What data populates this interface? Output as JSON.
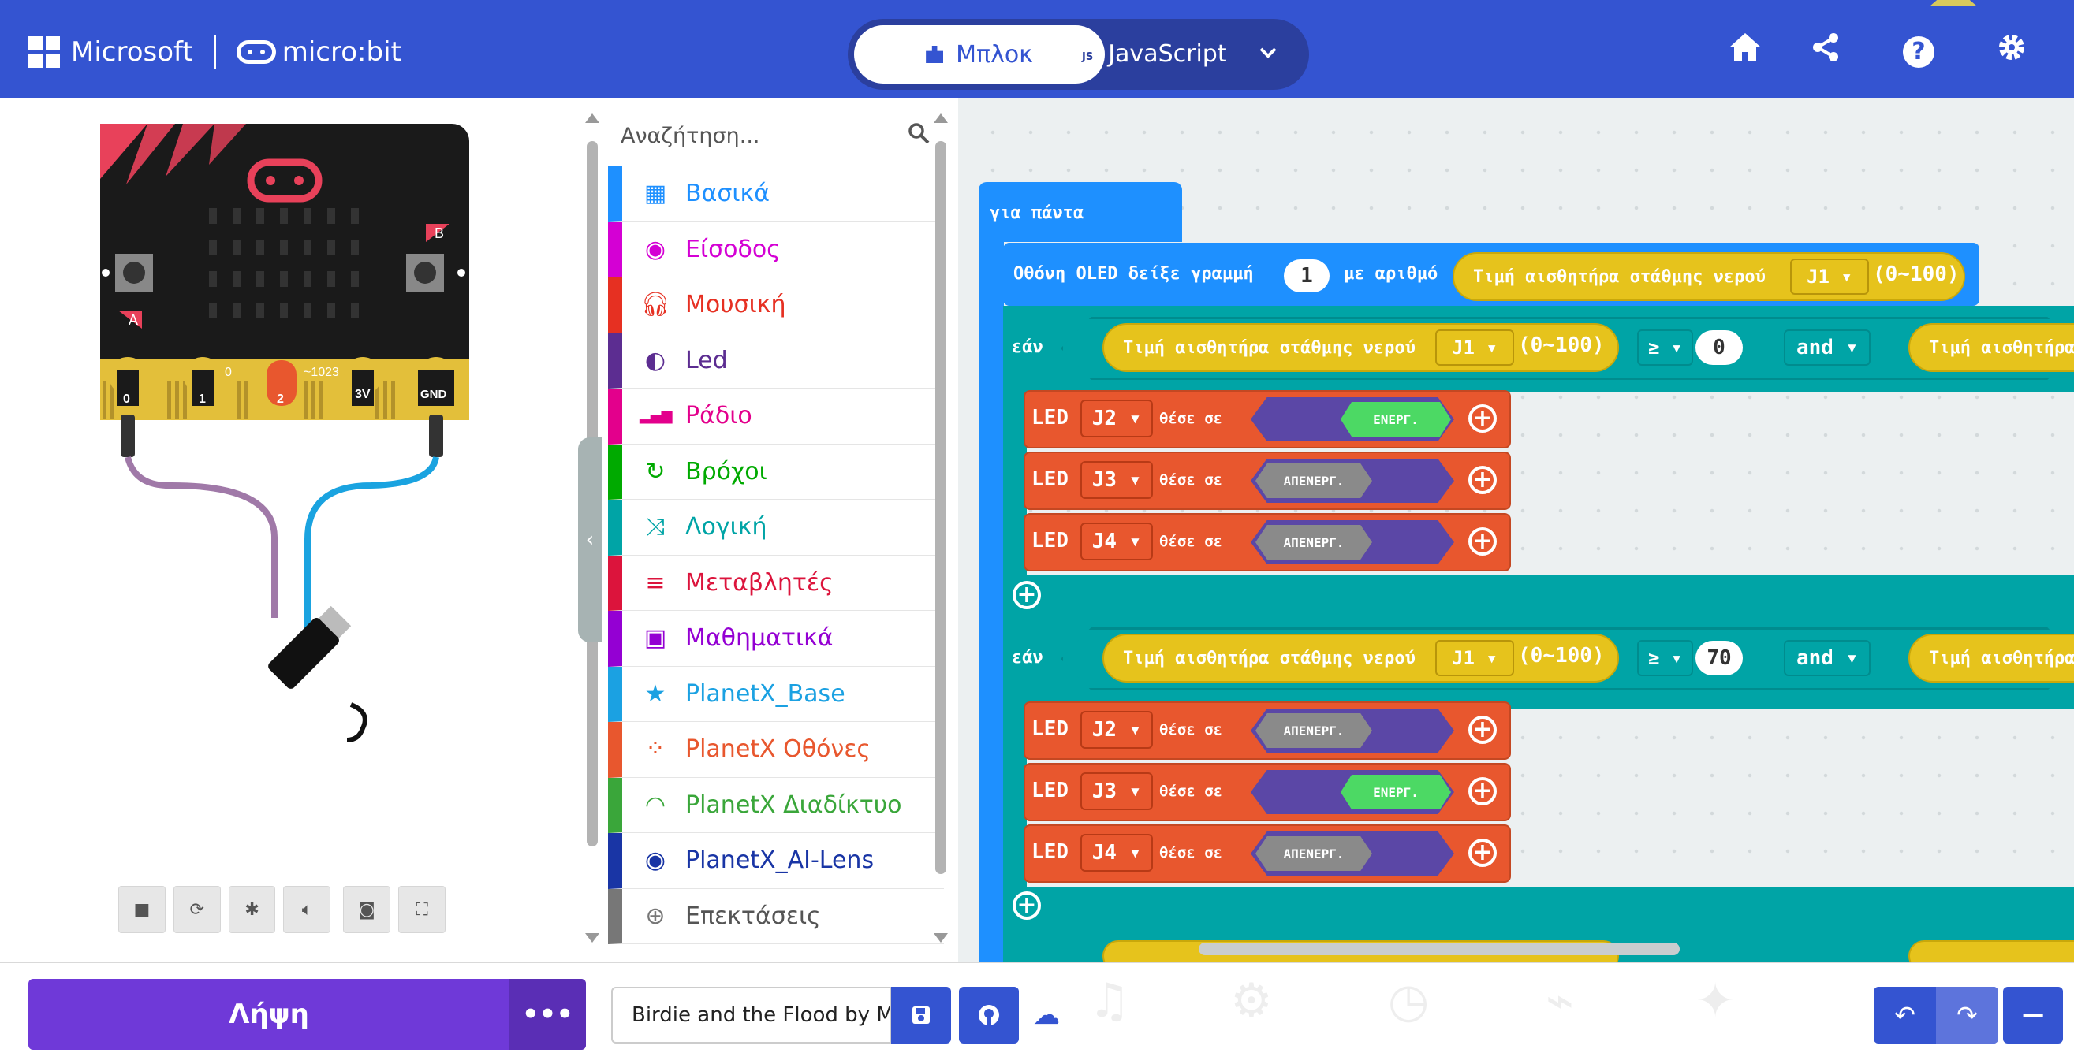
{
  "header": {
    "microsoft_label": "Microsoft",
    "microbit_label": "micro:bit",
    "tab_blocks": "Μπλοκ",
    "tab_js": "JavaScript",
    "js_badge": "JS",
    "icons": [
      "home-icon",
      "share-icon",
      "help-icon",
      "settings-icon"
    ],
    "help_glyph": "?"
  },
  "simulator": {
    "pins": [
      "0",
      "1",
      "2",
      "3V",
      "GND"
    ],
    "pin0_value": "0",
    "pin_range": "~1023",
    "button_a": "A",
    "button_b": "B",
    "controls": [
      "stop-icon",
      "restart-icon",
      "debug-icon",
      "sound-icon",
      "screenshot-icon",
      "fullscreen-icon"
    ]
  },
  "toolbox": {
    "search_placeholder": "Αναζήτηση...",
    "categories": [
      {
        "label": "Βασικά",
        "color": "#1e90ff",
        "icon": "grid-icon"
      },
      {
        "label": "Είσοδος",
        "color": "#d400d4",
        "icon": "input-icon"
      },
      {
        "label": "Μουσική",
        "color": "#e63022",
        "icon": "headphones-icon"
      },
      {
        "label": "Led",
        "color": "#5c2d91",
        "icon": "toggle-icon"
      },
      {
        "label": "Ράδιο",
        "color": "#e3008c",
        "icon": "signal-bars-icon"
      },
      {
        "label": "Βρόχοι",
        "color": "#00aa00",
        "icon": "loop-icon"
      },
      {
        "label": "Λογική",
        "color": "#00a4a6",
        "icon": "shuffle-icon"
      },
      {
        "label": "Μεταβλητές",
        "color": "#dc143c",
        "icon": "lines-icon"
      },
      {
        "label": "Μαθηματικά",
        "color": "#9400d3",
        "icon": "calculator-icon"
      },
      {
        "label": "PlanetX_Base",
        "color": "#1ba1e2",
        "icon": "star-icon"
      },
      {
        "label": "PlanetX Οθόνες",
        "color": "#e8572e",
        "icon": "dots-circle-icon"
      },
      {
        "label": "PlanetX Διαδίκτυο",
        "color": "#3aa63a",
        "icon": "wifi-icon"
      },
      {
        "label": "PlanetX_AI-Lens",
        "color": "#1935a5",
        "icon": "eye-icon"
      },
      {
        "label": "Επεκτάσεις",
        "color": "#777777",
        "icon": "plus-circle-icon"
      }
    ]
  },
  "workspace": {
    "forever_label": "για πάντα",
    "oled_label": "Οθόνη OLED δείξε γραμμή",
    "oled_line": "1",
    "oled_num_label": "με αριθμό",
    "sensor_label": "Τιμή αισθητήρα στάθμης νερού",
    "sensor_label_cut": "Τιμή αισθητήρα",
    "pin_j1": "J1 ▾",
    "range": "(0~100)",
    "if_label": "εάν",
    "ge_op": "≥ ▾",
    "and_op": "and ▾",
    "if1_value": "0",
    "if2_value": "70",
    "led_label": "LED",
    "set_label": "θέσε σε",
    "on_label": "ΕΝΕΡΓ.",
    "off_label": "ΑΠΕΝΕΡΓ.",
    "if1_leds": [
      {
        "pin": "J2 ▾",
        "state": "on"
      },
      {
        "pin": "J3 ▾",
        "state": "off"
      },
      {
        "pin": "J4 ▾",
        "state": "off"
      }
    ],
    "if2_leds": [
      {
        "pin": "J2 ▾",
        "state": "off"
      },
      {
        "pin": "J3 ▾",
        "state": "on"
      },
      {
        "pin": "J4 ▾",
        "state": "off"
      }
    ]
  },
  "footer": {
    "download_label": "Λήψη",
    "more_label": "•••",
    "project_name": "Birdie and the Flood by M"
  }
}
